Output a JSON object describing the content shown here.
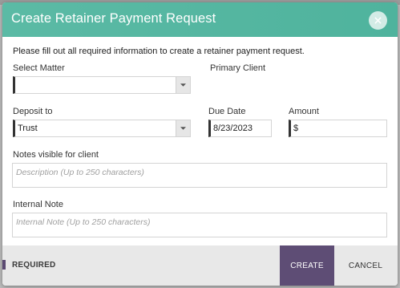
{
  "dialog": {
    "title": "Create Retainer Payment Request",
    "intro": "Please fill out all required information to create a retainer payment request."
  },
  "form": {
    "matter_label": "Select Matter",
    "matter_value": "",
    "primary_client_label": "Primary Client",
    "deposit_label": "Deposit to",
    "deposit_value": "Trust",
    "due_date_label": "Due Date",
    "due_date_value": "8/23/2023",
    "amount_label": "Amount",
    "amount_prefix": "$",
    "notes_label": "Notes visible for client",
    "notes_placeholder": "Description (Up to 250 characters)",
    "internal_label": "Internal Note",
    "internal_placeholder": "Internal Note (Up to 250 characters)"
  },
  "footer": {
    "required_label": "REQUIRED",
    "create_label": "CREATE",
    "cancel_label": "CANCEL"
  },
  "colors": {
    "header": "#52b69f",
    "primary_button": "#5e4d75",
    "required_marker": "#5b4a72"
  },
  "icons": {
    "close": "close-icon",
    "dropdown": "chevron-down-icon"
  }
}
